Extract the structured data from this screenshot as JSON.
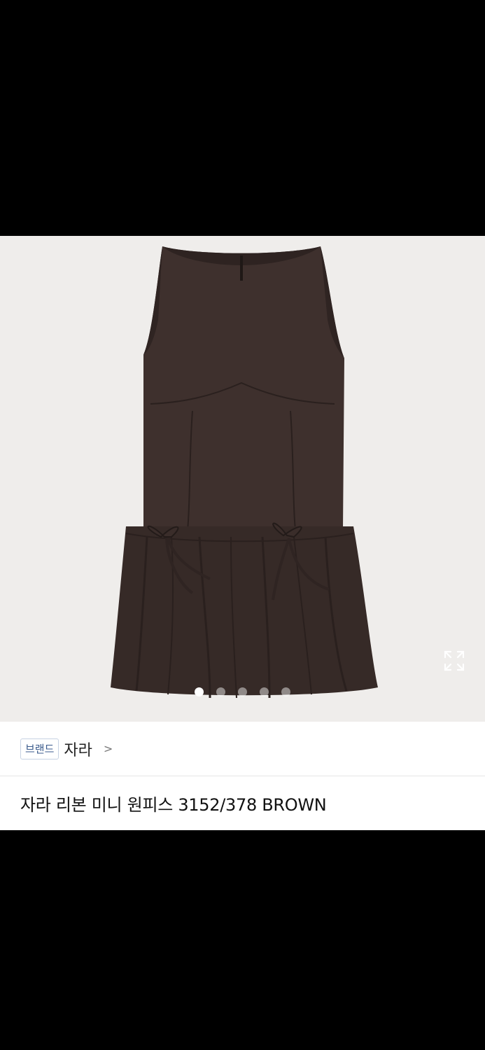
{
  "gallery": {
    "image_alt": "",
    "slide_count": 5,
    "active_slide": 1,
    "expand_icon": "expand-icon",
    "dress_color": "#3e302d",
    "background_color": "#efedeb"
  },
  "brand": {
    "badge_label": "브랜드",
    "name": "자라",
    "chevron": ">"
  },
  "product": {
    "title": "자라 리본 미니 원피스 3152/378 BROWN"
  }
}
